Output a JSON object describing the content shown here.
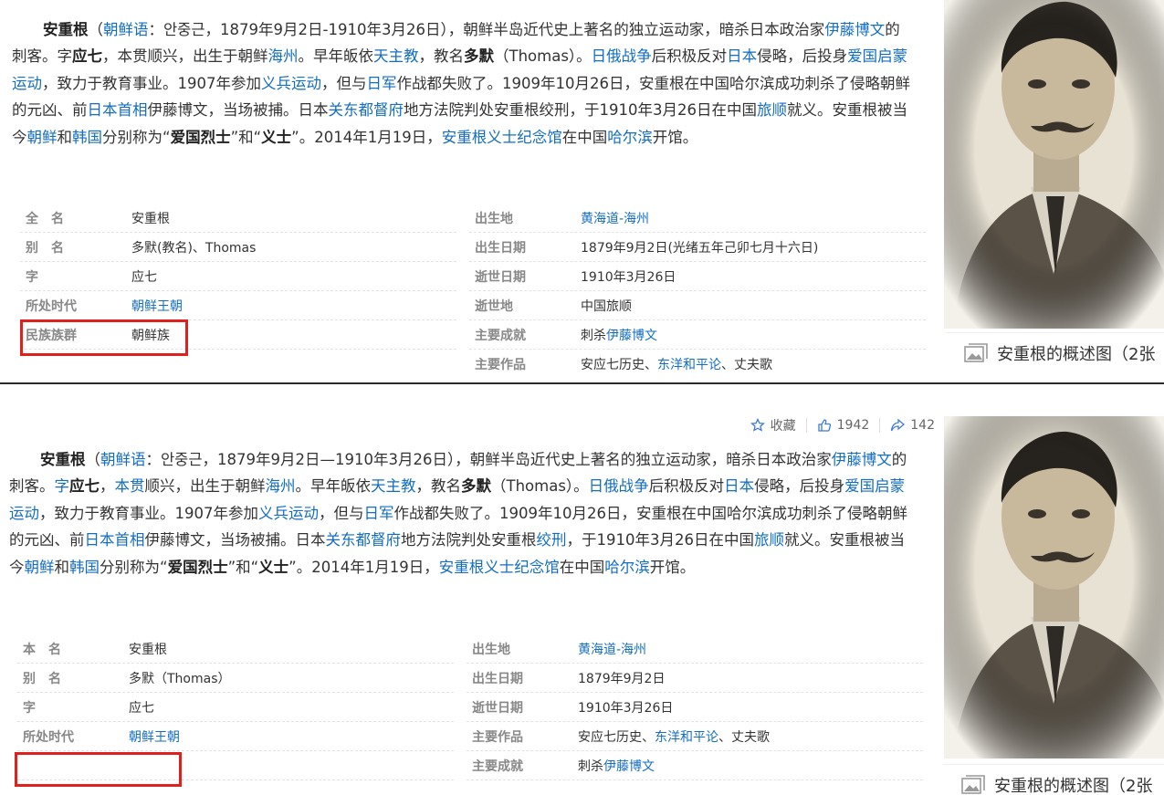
{
  "top": {
    "summary": {
      "name_bold": "安重根",
      "p1": "（",
      "link_korean": "朝鲜语",
      "p2": "：안중근，1879年9月2日-1910年3月26日），朝鲜半岛近代史上著名的独立运动家，暗杀日本政治家",
      "link_ito1": "伊藤博文",
      "p3": "的刺客。字",
      "bold_yingqi": "应七",
      "p4": "，本贯顺兴，出生于朝鲜",
      "link_haizhou": "海州",
      "p5": "。早年皈依",
      "link_catholic": "天主教",
      "p6": "，教名",
      "bold_duomo": "多默",
      "p7": "（Thomas）。",
      "link_war": "日俄战争",
      "p8": "后积极反对",
      "link_japan": "日本",
      "p9": "侵略，后投身",
      "link_enlight": "爱国启蒙运动",
      "p10": "，致力于教育事业。1907年参加",
      "link_righteous": "义兵运动",
      "p11": "，但与",
      "link_army": "日军",
      "p12": "作战都失败了。1909年10月26日，安重根在中国哈尔滨成功刺杀了侵略朝鲜的元凶、前",
      "link_pm": "日本首相",
      "p13": "伊藤博文，当场被捕。日本",
      "link_kwantung": "关东都督府",
      "p14": "地方法院判处安重根绞刑，于1910年3月26日在中国",
      "link_lushun": "旅顺",
      "p15": "就义。安重根被当今",
      "link_nk": "朝鲜",
      "p16": "和",
      "link_sk": "韩国",
      "p17": "分别称为“",
      "bold_patriot": "爱国烈士",
      "p18": "”和“",
      "bold_yishi": "义士",
      "p19": "”。2014年1月19日，",
      "link_memorial": "安重根义士纪念馆",
      "p20": "在中国",
      "link_harbin": "哈尔滨",
      "p21": "开馆。"
    },
    "info_left": [
      {
        "name": "全名",
        "value": "安重根",
        "link": false
      },
      {
        "name": "别名",
        "value": "多默(教名)、Thomas",
        "link": false
      },
      {
        "name": "字",
        "value": "应七",
        "link": false
      },
      {
        "name": "所处时代",
        "value": "朝鲜王朝",
        "link": true
      },
      {
        "name": "民族族群",
        "value": "朝鲜族",
        "link": false
      }
    ],
    "info_right": [
      {
        "name": "出生地",
        "value": "黄海道-海州",
        "link": true
      },
      {
        "name": "出生日期",
        "value": "1879年9月2日(光绪五年己卯七月十六日)",
        "link": false
      },
      {
        "name": "逝世日期",
        "value": "1910年3月26日",
        "link": false
      },
      {
        "name": "逝世地",
        "value": "中国旅顺",
        "link": false
      },
      {
        "name": "主要成就",
        "prefix": "刺杀",
        "linktext": "伊藤博文"
      },
      {
        "name": "主要作品",
        "prefix": "安应七历史、",
        "linktext": "东洋和平论",
        "suffix": "、丈夫歌"
      }
    ],
    "photo_caption": "安重根的概述图（2张"
  },
  "bottom": {
    "toolbar": {
      "favorite_label": "收藏",
      "like_count": "1942",
      "share_count": "142"
    },
    "summary": {
      "name_bold": "安重根",
      "p1": "（",
      "link_korean": "朝鲜语",
      "p2": "：안중근，1879年9月2日—1910年3月26日），朝鲜半岛近代史上著名的独立运动家，暗杀日本政治家",
      "link_ito1": "伊藤博文",
      "p3": "的刺客。",
      "link_zi": "字",
      "bold_yingqi": "应七",
      "p4": "，",
      "link_benguan": "本贯",
      "p4b": "顺兴，出生于朝鲜",
      "link_haizhou": "海州",
      "p5": "。早年皈依",
      "link_catholic": "天主教",
      "p6": "，教名",
      "bold_duomo": "多默",
      "p7": "（Thomas）。",
      "link_war": "日俄战争",
      "p8": "后积极反对",
      "link_japan": "日本",
      "p9": "侵略，后投身",
      "link_enlight": "爱国启蒙运动",
      "p10": "，致力于教育事业。1907年参加",
      "link_righteous": "义兵运动",
      "p11": "，但与",
      "link_army": "日军",
      "p12": "作战都失败了。1909年10月26日，安重根在中国哈尔滨成功刺杀了侵略朝鲜的元凶、前",
      "link_pm": "日本首相",
      "p13": "伊藤博文，当场被捕。日本",
      "link_kwantung": "关东都督府",
      "p14": "地方法院判处安重根",
      "link_hang": "绞刑",
      "p14b": "，于1910年3月26日在中国",
      "link_lushun": "旅顺",
      "p15": "就义。安重根被当今",
      "link_nk": "朝鲜",
      "p16": "和",
      "link_sk": "韩国",
      "p17": "分别称为“",
      "bold_patriot": "爱国烈士",
      "p18": "”和“",
      "bold_yishi": "义士",
      "p19": "”。2014年1月19日，",
      "link_memorial": "安重根义士纪念馆",
      "p20": "在中国",
      "link_harbin": "哈尔滨",
      "p21": "开馆。"
    },
    "info_left": [
      {
        "name": "本名",
        "value": "安重根",
        "link": false
      },
      {
        "name": "别名",
        "value": "多默（Thomas）",
        "link": false
      },
      {
        "name": "字",
        "value": "应七",
        "link": false
      },
      {
        "name": "所处时代",
        "value": "朝鲜王朝",
        "link": true
      },
      {
        "name": "",
        "value": "",
        "link": false
      }
    ],
    "info_right": [
      {
        "name": "出生地",
        "value": "黄海道-海州",
        "link": true
      },
      {
        "name": "出生日期",
        "value": "1879年9月2日",
        "link": false
      },
      {
        "name": "逝世日期",
        "value": "1910年3月26日",
        "link": false
      },
      {
        "name": "主要作品",
        "prefix": "安应七历史、",
        "linktext": "东洋和平论",
        "suffix": "、丈夫歌"
      },
      {
        "name": "主要成就",
        "prefix": "刺杀",
        "linktext": "伊藤博文"
      }
    ],
    "photo_caption": "安重根的概述图（2张"
  },
  "colors": {
    "link": "#136ec2",
    "highlight": "#e0201c",
    "label": "#888888"
  }
}
